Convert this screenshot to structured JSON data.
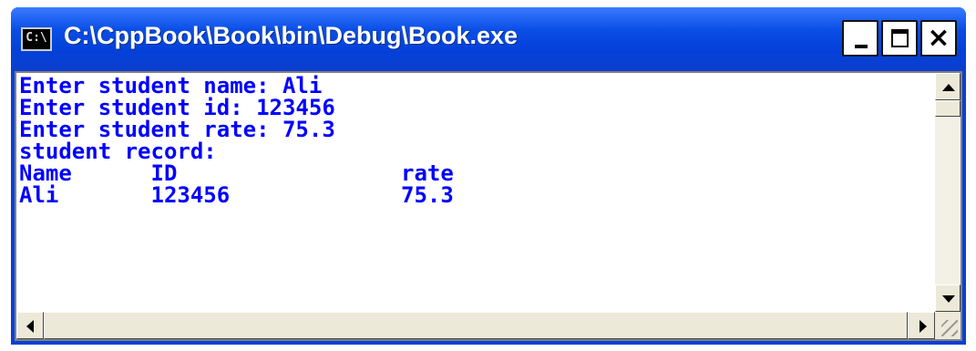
{
  "window": {
    "title": "C:\\CppBook\\Book\\bin\\Debug\\Book.exe",
    "icon": "console-app-icon",
    "icon_text": "C:\\",
    "buttons": {
      "minimize": "minimize-icon",
      "maximize": "maximize-icon",
      "close": "×"
    }
  },
  "console": {
    "text_color": "#0000ff",
    "background": "#ffffff",
    "lines": [
      "Enter student name: Ali",
      "Enter student id: 123456",
      "Enter student rate: 75.3",
      "student record:",
      "Name      ID                 rate",
      "Ali       123456             75.3"
    ]
  },
  "colors": {
    "titlebar": "#0a4ee6",
    "window_frame": "#0a3fd6",
    "chrome": "#ece9d8"
  }
}
